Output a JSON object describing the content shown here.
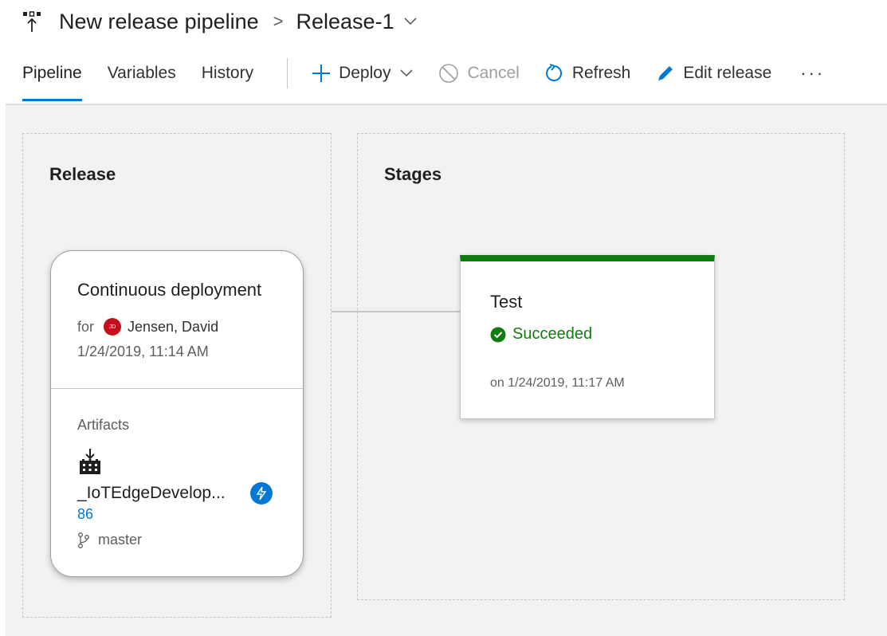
{
  "header": {
    "pipeline_name": "New release pipeline",
    "separator": ">",
    "release_name": "Release-1"
  },
  "tabs": [
    {
      "label": "Pipeline",
      "active": true
    },
    {
      "label": "Variables",
      "active": false
    },
    {
      "label": "History",
      "active": false
    }
  ],
  "actions": {
    "deploy": "Deploy",
    "cancel": "Cancel",
    "refresh": "Refresh",
    "edit_release": "Edit release",
    "more": "···"
  },
  "release_section": {
    "title": "Release",
    "card": {
      "trigger_title": "Continuous deployment",
      "for_label": "for",
      "avatar_initials": "JD",
      "user_name": "Jensen, David",
      "date": "1/24/2019, 11:14 AM",
      "artifacts_label": "Artifacts",
      "artifact_name": "_IoTEdgeDevelop...",
      "build_number": "86",
      "branch": "master"
    }
  },
  "stages_section": {
    "title": "Stages",
    "stage": {
      "name": "Test",
      "status": "Succeeded",
      "date": "on 1/24/2019, 11:17 AM"
    }
  },
  "colors": {
    "accent": "#0078d4",
    "success": "#107c10",
    "avatar": "#c50f1f"
  }
}
